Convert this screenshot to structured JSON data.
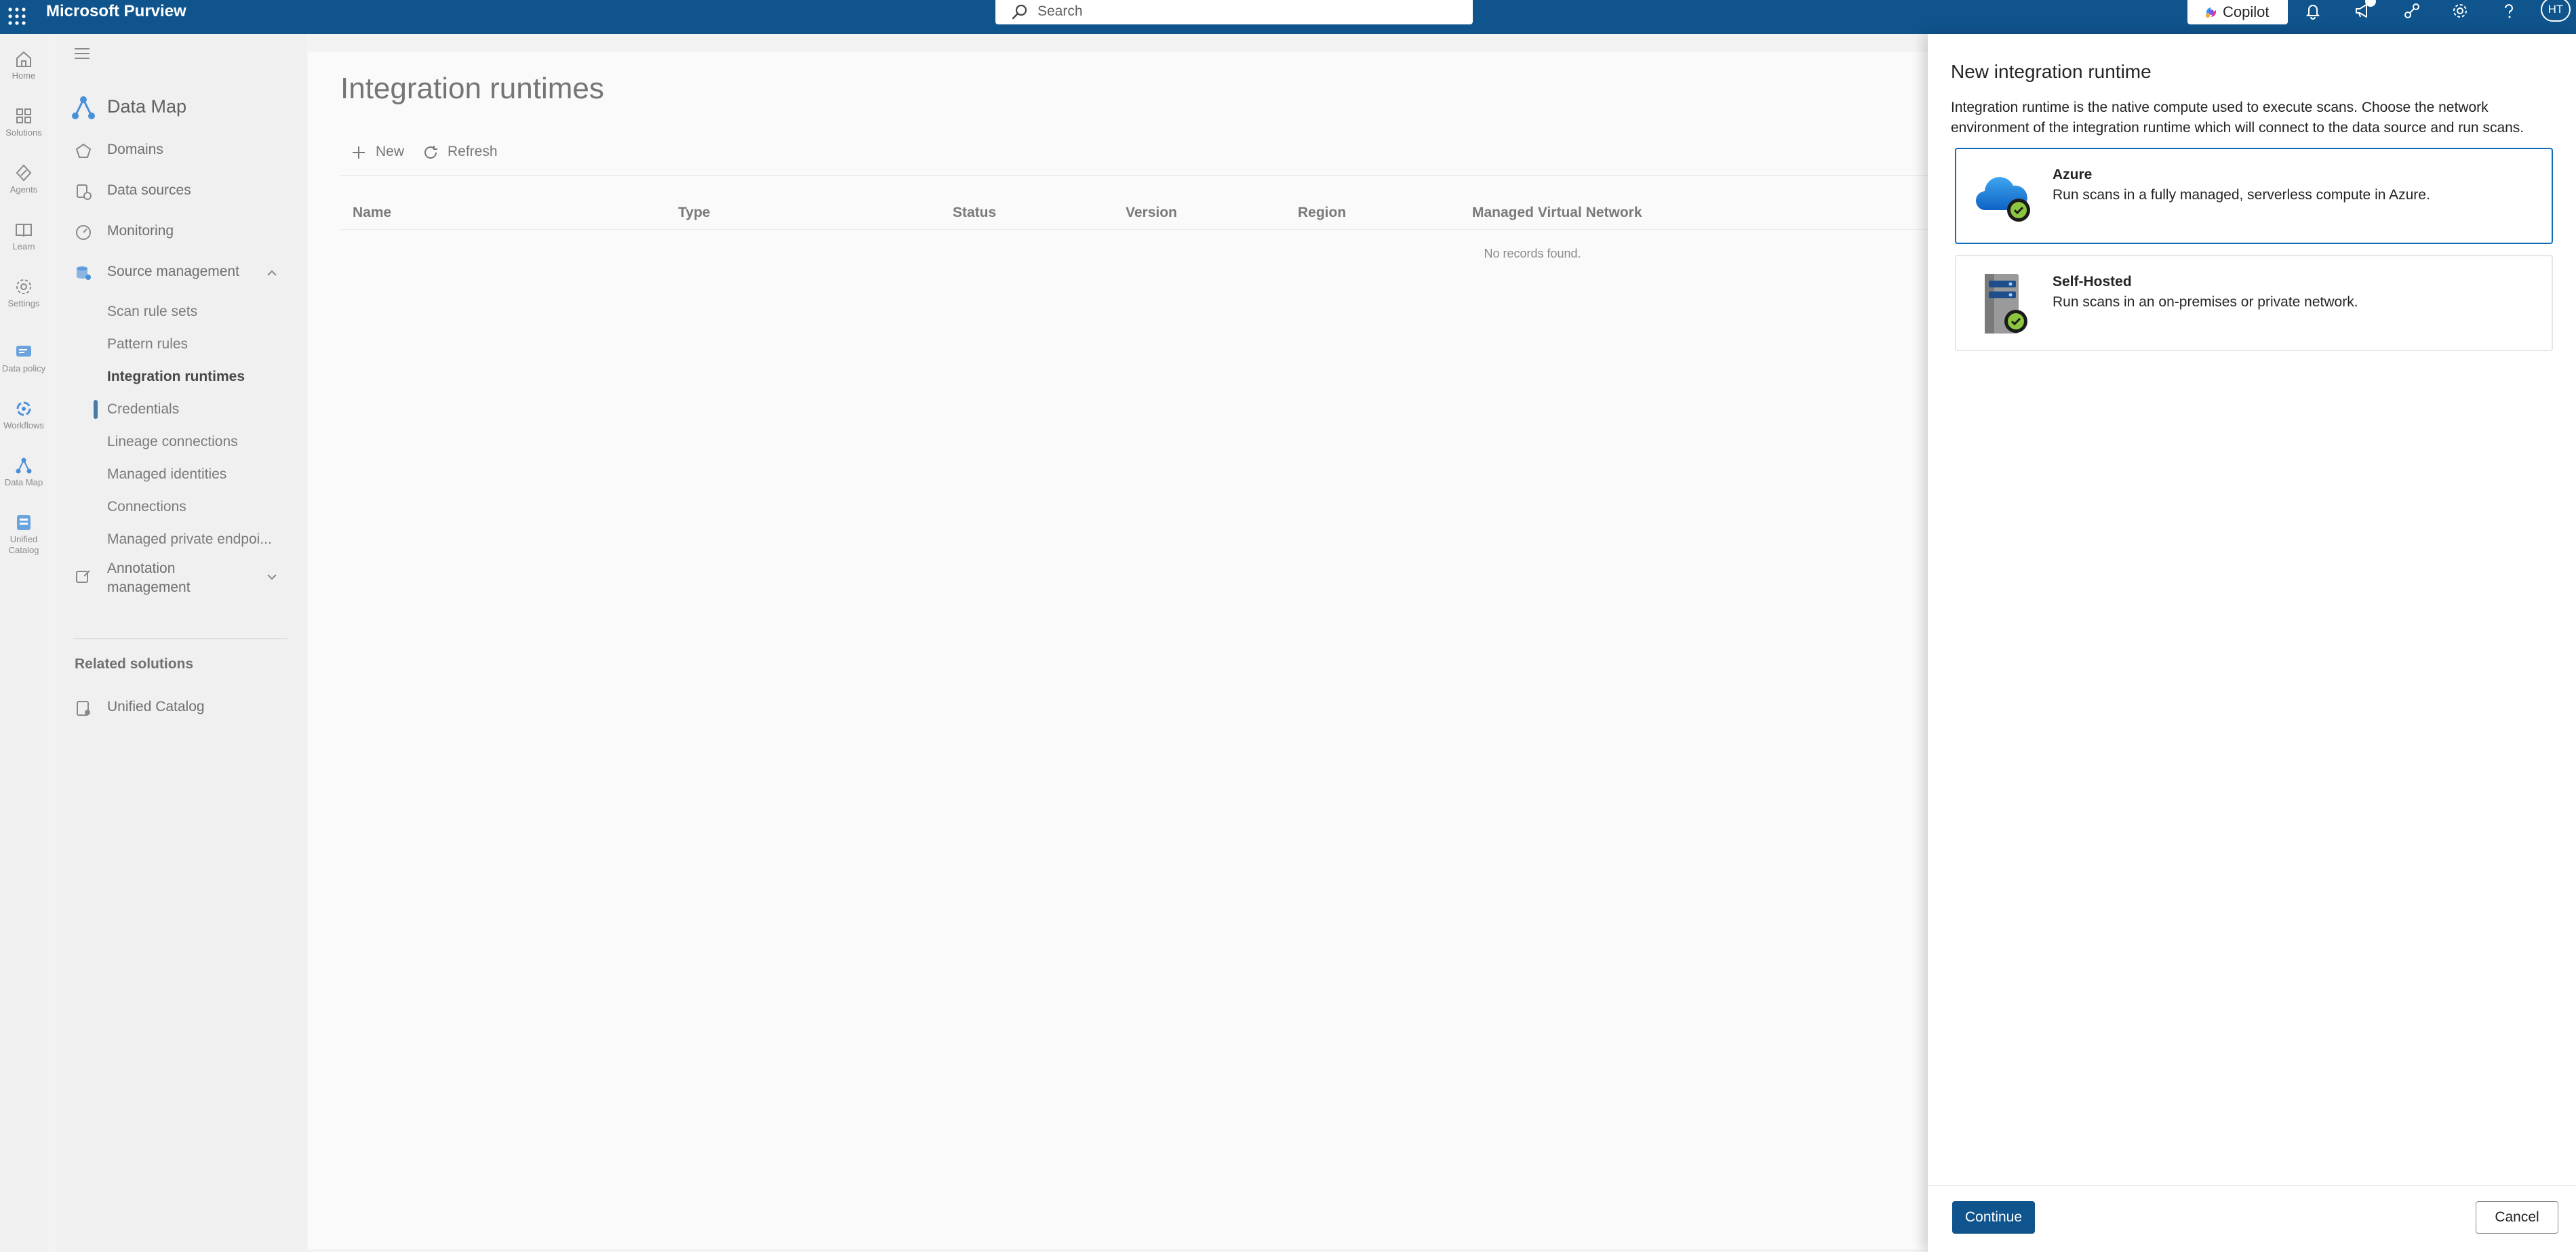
{
  "topbar": {
    "app_title": "Microsoft Purview",
    "search_placeholder": "Search",
    "copilot_label": "Copilot",
    "avatar_initials": "HT",
    "icons": [
      "app-launcher-icon",
      "search-icon",
      "copilot-icon",
      "bell-icon",
      "megaphone-icon",
      "share-icon",
      "gear-icon",
      "help-icon"
    ]
  },
  "rail": {
    "items": [
      {
        "label": "Home",
        "icon": "home-icon"
      },
      {
        "label": "Solutions",
        "icon": "solutions-icon"
      },
      {
        "label": "Agents",
        "icon": "agents-icon"
      },
      {
        "label": "Learn",
        "icon": "learn-icon"
      },
      {
        "label": "Settings",
        "icon": "settings-icon"
      },
      {
        "label": "Data policy",
        "icon": "data-policy-icon"
      },
      {
        "label": "Workflows",
        "icon": "workflows-icon"
      },
      {
        "label": "Data Map",
        "icon": "data-map-icon"
      },
      {
        "label": "Unified",
        "label2": "Catalog",
        "icon": "unified-catalog-icon"
      }
    ]
  },
  "nav": {
    "title": "Data Map",
    "items": {
      "domains": "Domains",
      "data_sources": "Data sources",
      "monitoring": "Monitoring",
      "source_management": "Source management",
      "annotation_management_1": "Annotation",
      "annotation_management_2": "management"
    },
    "source_management_children": [
      "Scan rule sets",
      "Pattern rules",
      "Integration runtimes",
      "Credentials",
      "Lineage connections",
      "Managed identities",
      "Connections",
      "Managed private endpoi..."
    ],
    "related_solutions_header": "Related solutions",
    "related_solutions": [
      "Unified Catalog"
    ]
  },
  "main": {
    "page_title": "Integration runtimes",
    "commands": {
      "new": "New",
      "refresh": "Refresh"
    },
    "columns": [
      "Name",
      "Type",
      "Status",
      "Version",
      "Region",
      "Managed Virtual Network"
    ],
    "empty_message": "No records found."
  },
  "panel": {
    "title": "New integration runtime",
    "description": "Integration runtime is the native compute used to execute scans. Choose the network environment of the integration runtime which will connect to the data source and run scans.",
    "options": [
      {
        "title": "Azure",
        "description": "Run scans in a fully managed, serverless compute in Azure.",
        "icon": "azure-cloud-icon",
        "selected": true
      },
      {
        "title": "Self-Hosted",
        "description": "Run scans in an on-premises or private network.",
        "icon": "server-icon",
        "selected": false
      }
    ],
    "continue_label": "Continue",
    "cancel_label": "Cancel"
  },
  "colors": {
    "brand": "#0f548c",
    "selection_border": "#0f6cbd",
    "runtime_badge": "#8cc63f"
  }
}
